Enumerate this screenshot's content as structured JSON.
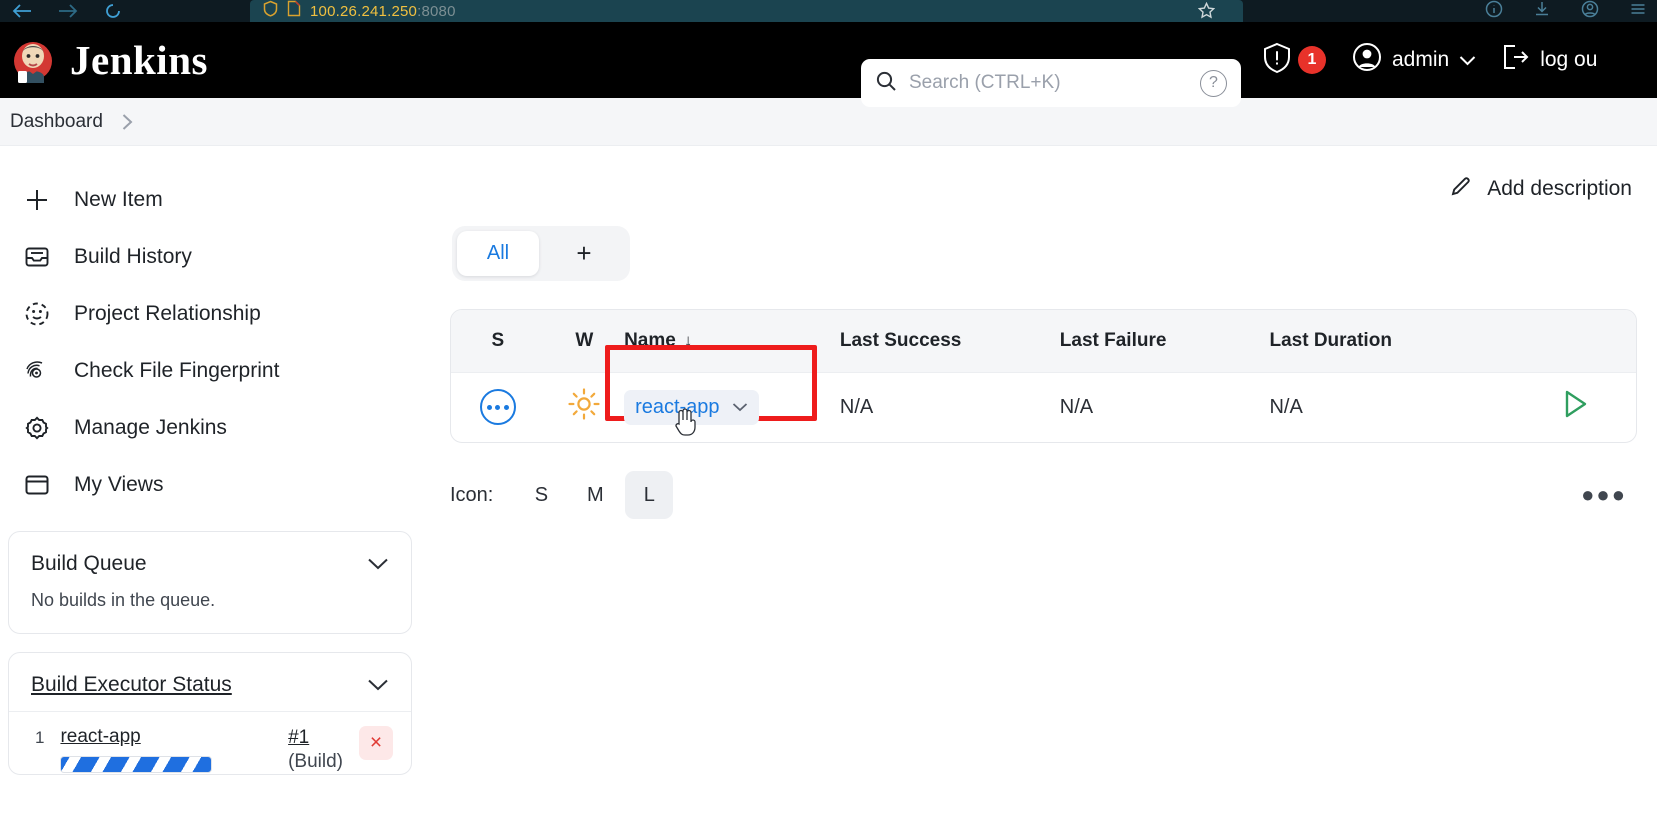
{
  "browser": {
    "url_host": "100.26.241.250",
    "url_port": ":8080",
    "back_icon": "back-arrow-icon",
    "forward_icon": "forward-arrow-icon",
    "reload_icon": "reload-icon",
    "shield_icon": "shield-icon",
    "page_icon": "page-icon",
    "star_icon": "star-icon"
  },
  "header": {
    "brand": "Jenkins",
    "search": {
      "placeholder": "Search (CTRL+K)",
      "value": ""
    },
    "help_label": "?",
    "security_badge_count": "1",
    "user_name": "admin",
    "logout_label": "log ou",
    "accent_blue": "#1a7ae0"
  },
  "breadcrumb": {
    "items": [
      "Dashboard"
    ]
  },
  "sidebar": {
    "items": [
      {
        "label": "New Item",
        "icon": "plus-icon"
      },
      {
        "label": "Build History",
        "icon": "inbox-icon"
      },
      {
        "label": "Project Relationship",
        "icon": "relationship-icon"
      },
      {
        "label": "Check File Fingerprint",
        "icon": "fingerprint-icon"
      },
      {
        "label": "Manage Jenkins",
        "icon": "gear-icon"
      },
      {
        "label": "My Views",
        "icon": "window-icon"
      }
    ],
    "build_queue": {
      "title": "Build Queue",
      "empty_message": "No builds in the queue."
    },
    "executor_status": {
      "title": "Build Executor Status",
      "rows": [
        {
          "number": "1",
          "job": "react-app",
          "build_number": "#1",
          "build_stage": "(Build)",
          "cancel_label": "×"
        }
      ]
    }
  },
  "main": {
    "add_description": "Add description",
    "tabs": [
      {
        "label": "All",
        "active": true
      },
      {
        "label": "+",
        "active": false
      }
    ],
    "table": {
      "columns": [
        "S",
        "W",
        "Name",
        "Last Success",
        "Last Failure",
        "Last Duration"
      ],
      "sort_column": "Name",
      "sort_arrow": "↓",
      "rows": [
        {
          "status_icon": "pending-dots-icon",
          "weather_icon": "sunny-icon",
          "name": "react-app",
          "last_success": "N/A",
          "last_failure": "N/A",
          "last_duration": "N/A",
          "action_icon": "play-icon"
        }
      ]
    },
    "icon_size": {
      "label": "Icon:",
      "options": [
        "S",
        "M",
        "L"
      ],
      "selected": "L"
    },
    "overflow_menu": "●●●"
  },
  "colors": {
    "highlight_box": "#ee1c1c",
    "link_blue": "#1a7ae0",
    "weather_sun": "#f2a93b",
    "play_green": "#2f9e5f",
    "danger_red": "#e03b35"
  }
}
